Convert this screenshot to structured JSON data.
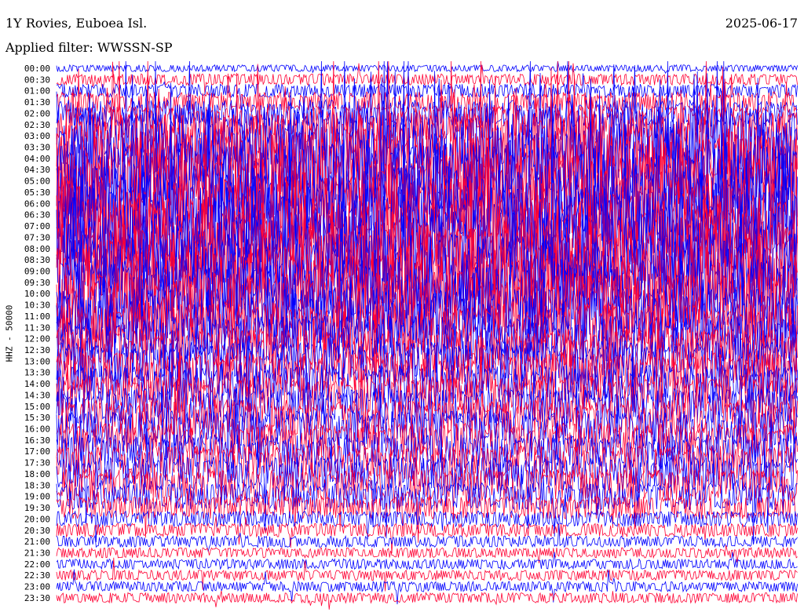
{
  "header": {
    "title": "1Y Rovies, Euboea Isl.",
    "date": "2025-06-17",
    "filter": "Applied filter: WWSSN-SP"
  },
  "channel_label": "HHZ - 50000",
  "colors": {
    "alternate_1": "#0000ff",
    "alternate_2": "#ff0033",
    "background": "#ffffff"
  },
  "chart_data": {
    "type": "line",
    "title": "1Y Rovies, Euboea Isl.",
    "ylabel": "HHZ - 50000",
    "xlabel": "",
    "row_labels": [
      "00:00",
      "00:30",
      "01:00",
      "01:30",
      "02:00",
      "02:30",
      "03:00",
      "03:30",
      "04:00",
      "04:30",
      "05:00",
      "05:30",
      "06:00",
      "06:30",
      "07:00",
      "07:30",
      "08:00",
      "08:30",
      "09:00",
      "09:30",
      "10:00",
      "10:30",
      "11:00",
      "11:30",
      "12:00",
      "12:30",
      "13:00",
      "13:30",
      "14:00",
      "14:30",
      "15:00",
      "15:30",
      "16:00",
      "16:30",
      "17:00",
      "17:30",
      "18:00",
      "18:30",
      "19:00",
      "19:30",
      "20:00",
      "20:30",
      "21:00",
      "21:30",
      "22:00",
      "22:30",
      "23:00",
      "23:30"
    ],
    "minutes_per_row": 30,
    "relative_amplitude_per_row": [
      0.3,
      0.5,
      0.6,
      0.9,
      1.2,
      1.6,
      2.6,
      3.0,
      3.2,
      3.3,
      3.4,
      3.4,
      3.4,
      3.4,
      3.5,
      3.5,
      3.5,
      3.4,
      3.3,
      3.2,
      3.1,
      2.9,
      2.5,
      2.2,
      2.0,
      1.9,
      1.8,
      1.8,
      1.7,
      1.7,
      1.6,
      1.6,
      1.6,
      1.5,
      1.5,
      1.5,
      1.5,
      1.4,
      1.2,
      1.0,
      0.7,
      0.6,
      0.5,
      0.45,
      0.45,
      0.45,
      0.45,
      0.45
    ],
    "series": [
      {
        "name": "",
        "color": "#0000ff",
        "rows": "even"
      },
      {
        "name": "",
        "color": "#ff0033",
        "rows": "odd"
      }
    ],
    "grid": false,
    "legend": "none"
  }
}
